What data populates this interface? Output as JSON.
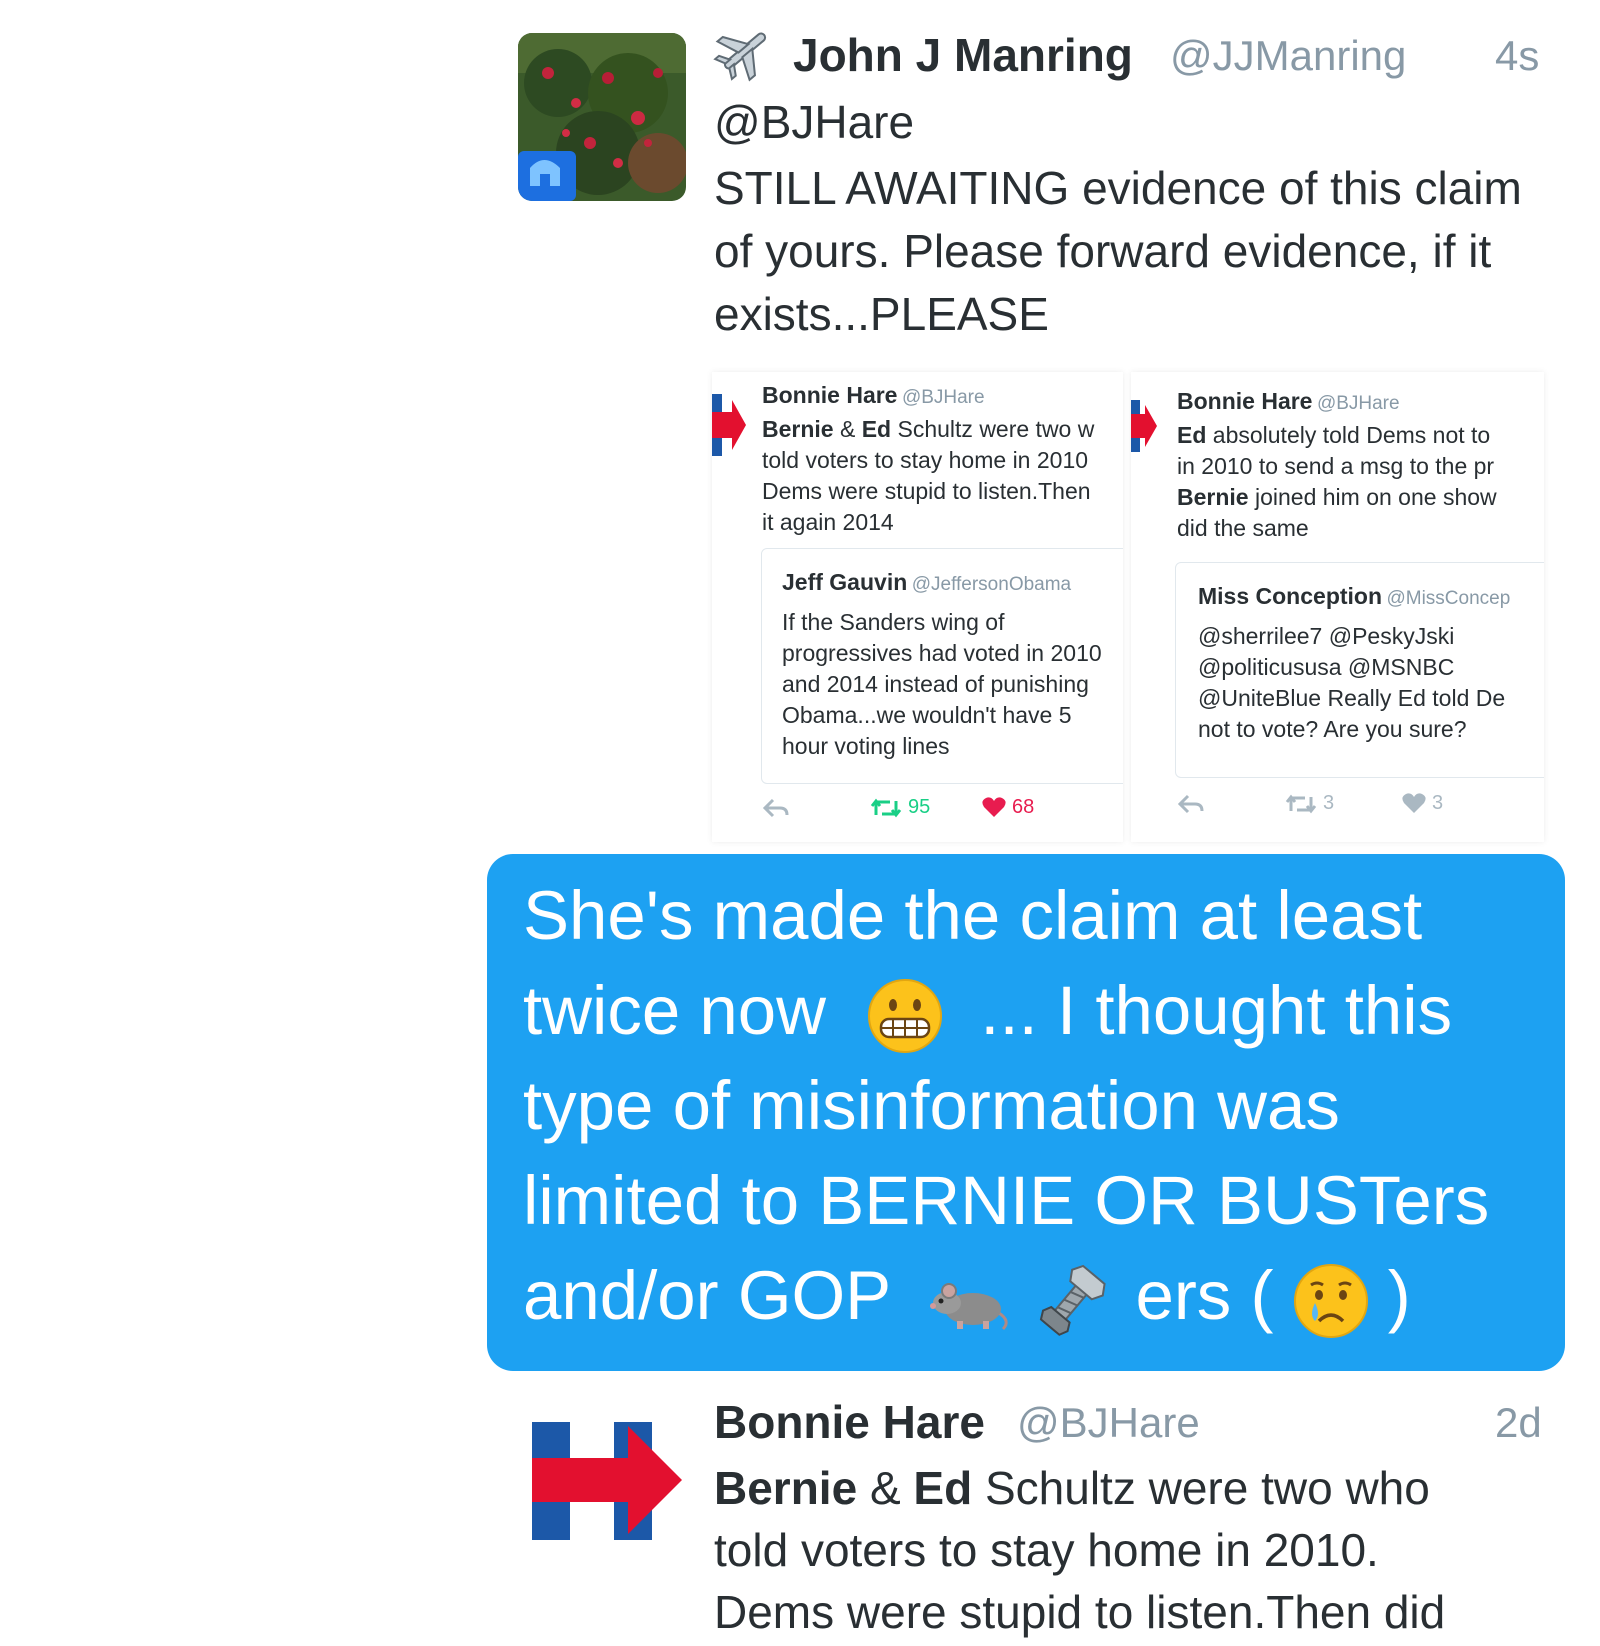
{
  "tweet1": {
    "name": "John J Manring",
    "handle": "@JJManring",
    "time": "4s",
    "mention": "@BJHare",
    "body": "STILL AWAITING evidence of this claim of yours. Please forward evidence, if it exists...PLEASE",
    "avatar_icon": "flower-photo-avatar",
    "name_icon": "airplane-icon"
  },
  "embed_left": {
    "name": "Bonnie Hare",
    "handle": "@BJHare",
    "lines": [
      "Bernie & Ed Schultz were two w",
      "told voters to stay home in 2010",
      "Dems were stupid to listen.Then",
      "it again 2014"
    ],
    "quote": {
      "name": "Jeff Gauvin",
      "handle": "@JeffersonObama",
      "lines": [
        "If the Sanders wing of",
        "progressives had voted in 2010",
        "and 2014 instead of punishing",
        "Obama...we wouldn't have 5",
        "hour voting lines"
      ]
    },
    "retweets": "95",
    "likes": "68"
  },
  "embed_right": {
    "name": "Bonnie Hare",
    "handle": "@BJHare",
    "lines": [
      "Ed absolutely told Dems not to",
      "in 2010 to send a msg to the pr",
      "Bernie joined him on one show",
      "did the same"
    ],
    "quote": {
      "name": "Miss Conception",
      "handle": "@MissConcep",
      "lines": [
        "@sherrilee7 @PeskyJski",
        "@politicususa @MSNBC",
        "@UniteBlue Really Ed told De",
        "not to vote? Are you sure?"
      ]
    },
    "retweets": "3",
    "likes": "3"
  },
  "caption": {
    "line1": "She's made the claim at least",
    "line2a": "twice now",
    "line2b": "... I thought this",
    "line3": "type of misinformation was",
    "line4": "limited to BERNIE OR BUSTers",
    "line5a": "and/or GOP",
    "line5b": "ers (",
    "line5c": ")",
    "emoji": [
      "grimacing-face",
      "rat",
      "nut-and-bolt",
      "crying-face"
    ],
    "background": "#1da1f2"
  },
  "tweet2": {
    "name": "Bonnie Hare",
    "handle": "@BJHare",
    "time": "2d",
    "b1": "Bernie",
    "t1": " & ",
    "b2": "Ed",
    "t2": " Schultz were two who",
    "line2": "told voters to stay home in 2010.",
    "line3": "Dems were stupid to listen.Then did",
    "avatar_icon": "hillary-h-logo"
  },
  "colors": {
    "text": "#292f33",
    "muted": "#8899a6",
    "retweet": "#19cf86",
    "like": "#e81c4f",
    "logo_blue": "#1c58a8",
    "logo_red": "#e3102f"
  }
}
